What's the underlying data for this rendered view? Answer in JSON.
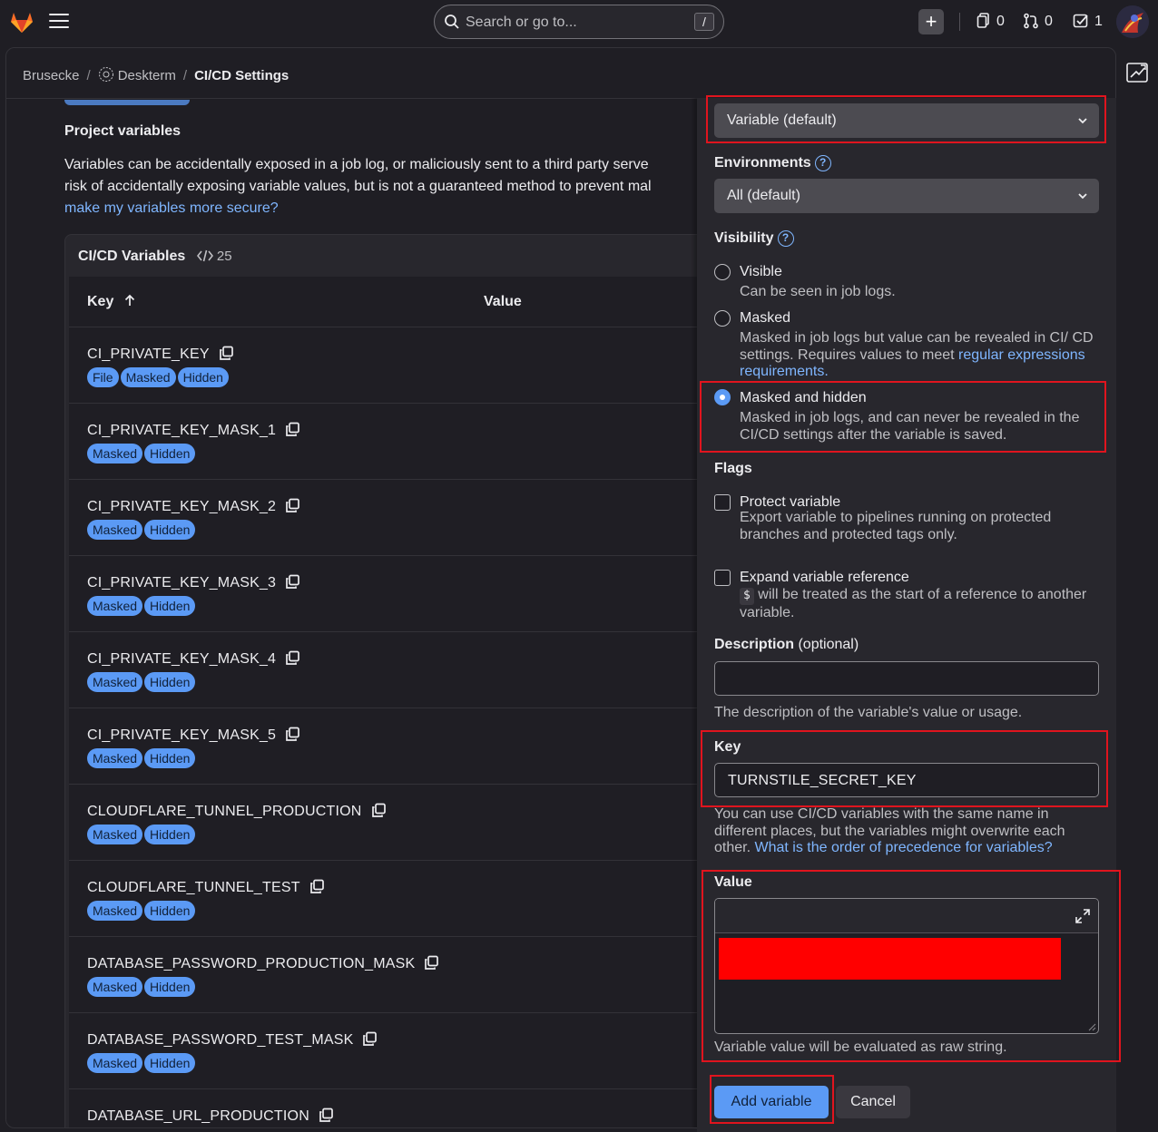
{
  "topbar": {
    "search_placeholder": "Search or go to...",
    "search_shortcut": "/",
    "plus_label": "+",
    "issues_count": "0",
    "merge_requests_count": "0",
    "todos_count": "1"
  },
  "breadcrumb": {
    "items": [
      "Brusecke",
      "Deskterm",
      "CI/CD Settings"
    ]
  },
  "section": {
    "title": "Project variables",
    "desc_line1": "Variables can be accidentally exposed in a job log, or maliciously sent to a third party serve",
    "desc_line2": "risk of accidentally exposing variable values, but is not a guaranteed method to prevent mal",
    "link": "make my variables more secure?"
  },
  "variables_card": {
    "title": "CI/CD Variables",
    "count": "25",
    "col_key": "Key",
    "col_value": "Value",
    "rows": [
      {
        "key": "CI_PRIVATE_KEY",
        "badges": [
          "File",
          "Masked",
          "Hidden"
        ]
      },
      {
        "key": "CI_PRIVATE_KEY_MASK_1",
        "badges": [
          "Masked",
          "Hidden"
        ]
      },
      {
        "key": "CI_PRIVATE_KEY_MASK_2",
        "badges": [
          "Masked",
          "Hidden"
        ]
      },
      {
        "key": "CI_PRIVATE_KEY_MASK_3",
        "badges": [
          "Masked",
          "Hidden"
        ]
      },
      {
        "key": "CI_PRIVATE_KEY_MASK_4",
        "badges": [
          "Masked",
          "Hidden"
        ]
      },
      {
        "key": "CI_PRIVATE_KEY_MASK_5",
        "badges": [
          "Masked",
          "Hidden"
        ]
      },
      {
        "key": "CLOUDFLARE_TUNNEL_PRODUCTION",
        "badges": [
          "Masked",
          "Hidden"
        ]
      },
      {
        "key": "CLOUDFLARE_TUNNEL_TEST",
        "badges": [
          "Masked",
          "Hidden"
        ]
      },
      {
        "key": "DATABASE_PASSWORD_PRODUCTION_MASK",
        "badges": [
          "Masked",
          "Hidden"
        ]
      },
      {
        "key": "DATABASE_PASSWORD_TEST_MASK",
        "badges": [
          "Masked",
          "Hidden"
        ]
      },
      {
        "key": "DATABASE_URL_PRODUCTION",
        "badges": []
      }
    ]
  },
  "drawer": {
    "type_select": "Variable (default)",
    "environments_label": "Environments",
    "environments_select": "All (default)",
    "visibility_label": "Visibility",
    "visibility_options": [
      {
        "title": "Visible",
        "desc": "Can be seen in job logs.",
        "selected": false
      },
      {
        "title": "Masked",
        "desc": "Masked in job logs but value can be revealed in CI/ CD settings. Requires values to meet ",
        "link": "regular expressions requirements.",
        "selected": false
      },
      {
        "title": "Masked and hidden",
        "desc": "Masked in job logs, and can never be revealed in the CI/CD settings after the variable is saved.",
        "selected": true
      }
    ],
    "flags_label": "Flags",
    "flags": [
      {
        "title": "Protect variable",
        "desc": "Export variable to pipelines running on protected branches and protected tags only.",
        "checked": false
      },
      {
        "title": "Expand variable reference",
        "code": "$",
        "desc": " will be treated as the start of a reference to another variable.",
        "checked": false
      }
    ],
    "description_label": "Description",
    "description_optional": "(optional)",
    "description_value": "",
    "description_help": "The description of the variable's value or usage.",
    "key_label": "Key",
    "key_value": "TURNSTILE_SECRET_KEY",
    "key_help": "You can use CI/CD variables with the same name in different places, but the variables might overwrite each other. ",
    "key_help_link": "What is the order of precedence for variables?",
    "value_label": "Value",
    "value_help": "Variable value will be evaluated as raw string.",
    "add_button": "Add variable",
    "cancel_button": "Cancel"
  },
  "colors": {
    "accent": "#5b9af5",
    "highlight": "#e0141e",
    "redaction": "#ff0000"
  }
}
